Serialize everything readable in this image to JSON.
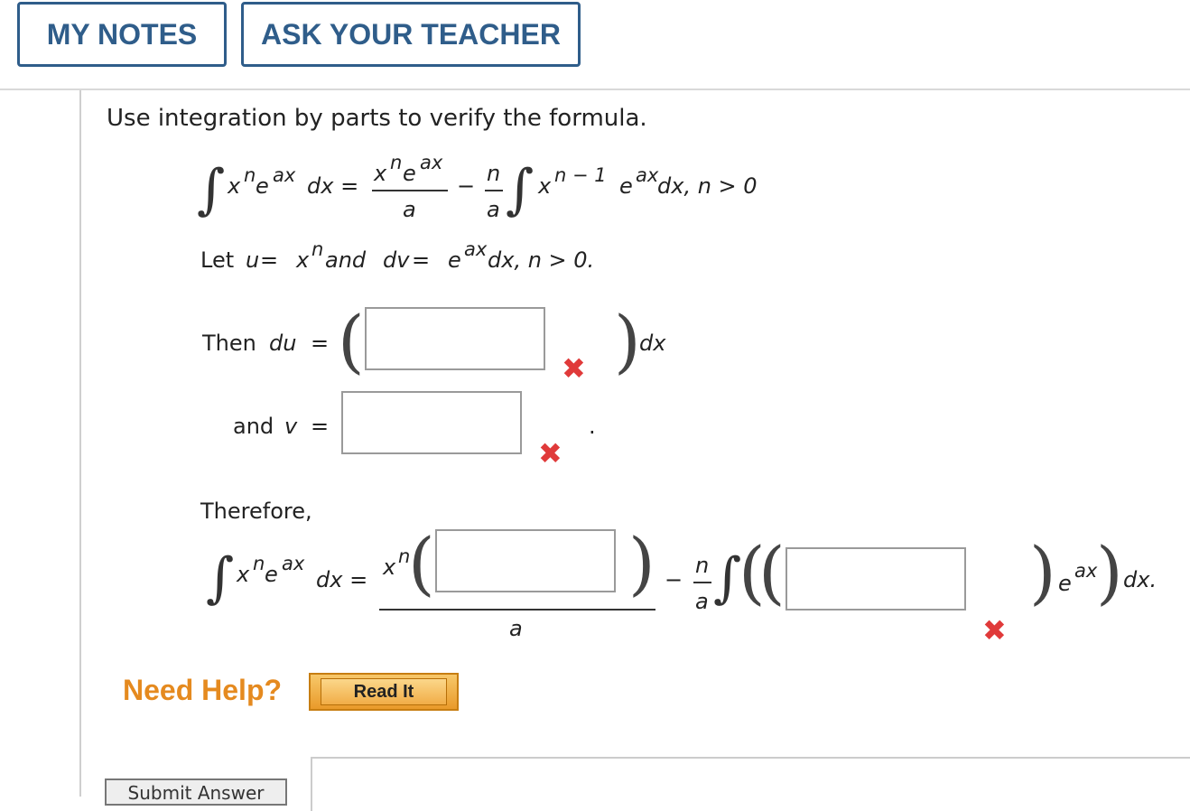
{
  "header": {
    "my_notes_label": "MY NOTES",
    "ask_teacher_label": "ASK YOUR TEACHER"
  },
  "question": {
    "prompt": "Use integration by parts to verify the formula.",
    "formula": {
      "integrand_base": "x",
      "integrand_exp_n": "n",
      "integrand_e": "e",
      "integrand_exp_ax": "ax",
      "dx_eq": "dx =",
      "frac1_num_x": "x",
      "frac1_num_n": "n",
      "frac1_num_e": "e",
      "frac1_num_ax": "ax",
      "frac1_den": "a",
      "minus": "−",
      "frac2_num": "n",
      "frac2_den": "a",
      "rhs_x": "x",
      "rhs_exp": "n − 1",
      "rhs_e": "e",
      "rhs_ax": "ax",
      "rhs_tail": "dx, n > 0"
    },
    "substitution": {
      "let": "Let ",
      "u": "u",
      "eq1": " = ",
      "xn_x": "x",
      "xn_n": "n",
      "and": " and ",
      "dv": "dv",
      "eq2": " = ",
      "e": "e",
      "ax": "ax",
      "tail": " dx, n > 0."
    },
    "du_row": {
      "then": "Then ",
      "du": "du",
      "eq": "=",
      "dx": "dx",
      "input_value": ""
    },
    "v_row": {
      "and": "and ",
      "v": "v",
      "eq": "=",
      "period": ".",
      "input_value": ""
    },
    "therefore": "Therefore,",
    "final": {
      "x": "x",
      "n": "n",
      "e": "e",
      "ax": "ax",
      "dx_eq": "dx =",
      "num_x": "x",
      "num_n": "n",
      "den": "a",
      "minus": "−",
      "frac_num": "n",
      "frac_den": "a",
      "e2": "e",
      "ax2": "ax",
      "dx_end": "dx.",
      "input1_value": "",
      "input2_value": ""
    }
  },
  "help": {
    "need_help": "Need Help?",
    "read_it": "Read It"
  },
  "actions": {
    "submit": "Submit Answer"
  },
  "colors": {
    "header_accent": "#2f5d8a",
    "error_mark": "#e03a3a",
    "help_orange": "#e58a1f"
  }
}
